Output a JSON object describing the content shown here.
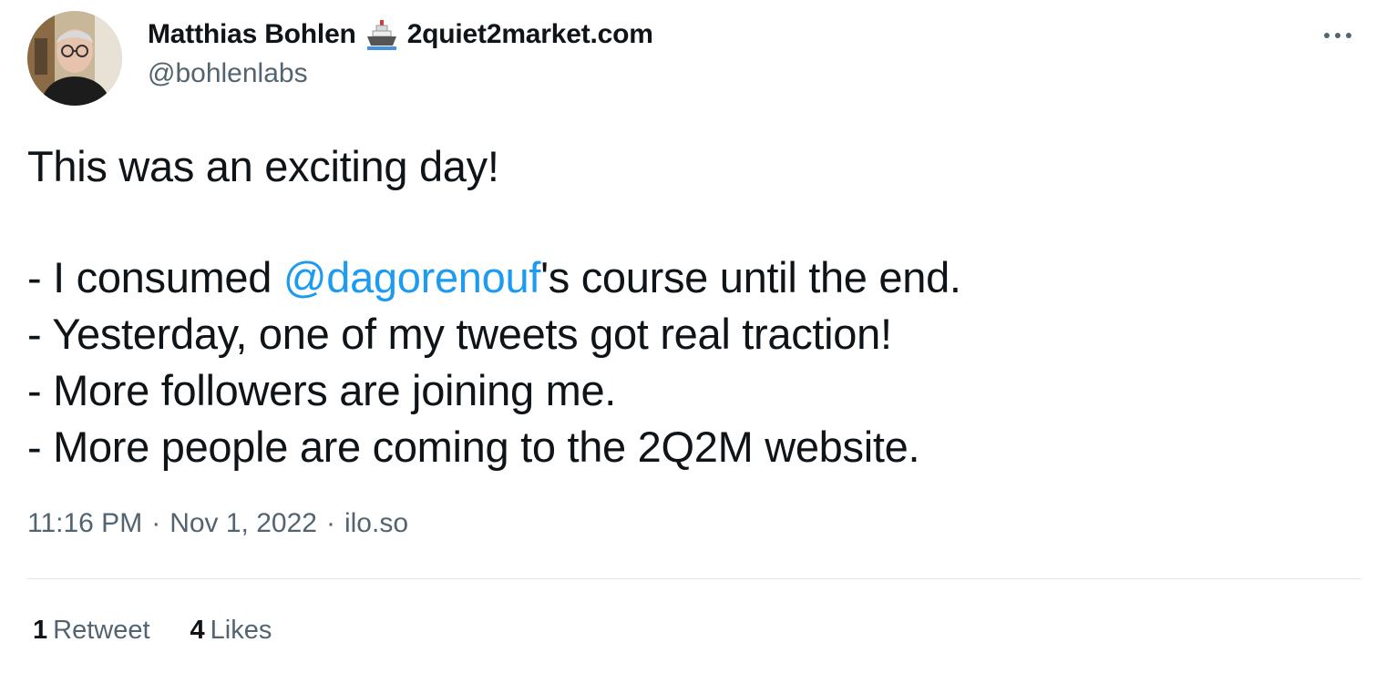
{
  "author": {
    "display_name": "Matthias Bohlen",
    "domain": "2quiet2market.com",
    "handle": "@bohlenlabs",
    "emoji_icon": "ship-icon"
  },
  "tweet": {
    "line1": "This was an exciting day!",
    "line2_prefix": "- I consumed ",
    "line2_mention": "@dagorenouf",
    "line2_suffix": "'s course until the end.",
    "line3": "- Yesterday, one of my tweets got real traction!",
    "line4": "- More followers are joining me.",
    "line5": "- More people are coming to the 2Q2M website."
  },
  "meta": {
    "time": "11:16 PM",
    "date": "Nov 1, 2022",
    "source": "ilo.so",
    "separator": "·"
  },
  "stats": {
    "retweets_count": "1",
    "retweets_label": "Retweet",
    "likes_count": "4",
    "likes_label": "Likes"
  },
  "colors": {
    "text": "#0f1419",
    "secondary": "#536471",
    "link": "#1d9bf0",
    "divider": "#e1e8ed"
  },
  "icons": {
    "more": "more-horizontal-icon"
  }
}
